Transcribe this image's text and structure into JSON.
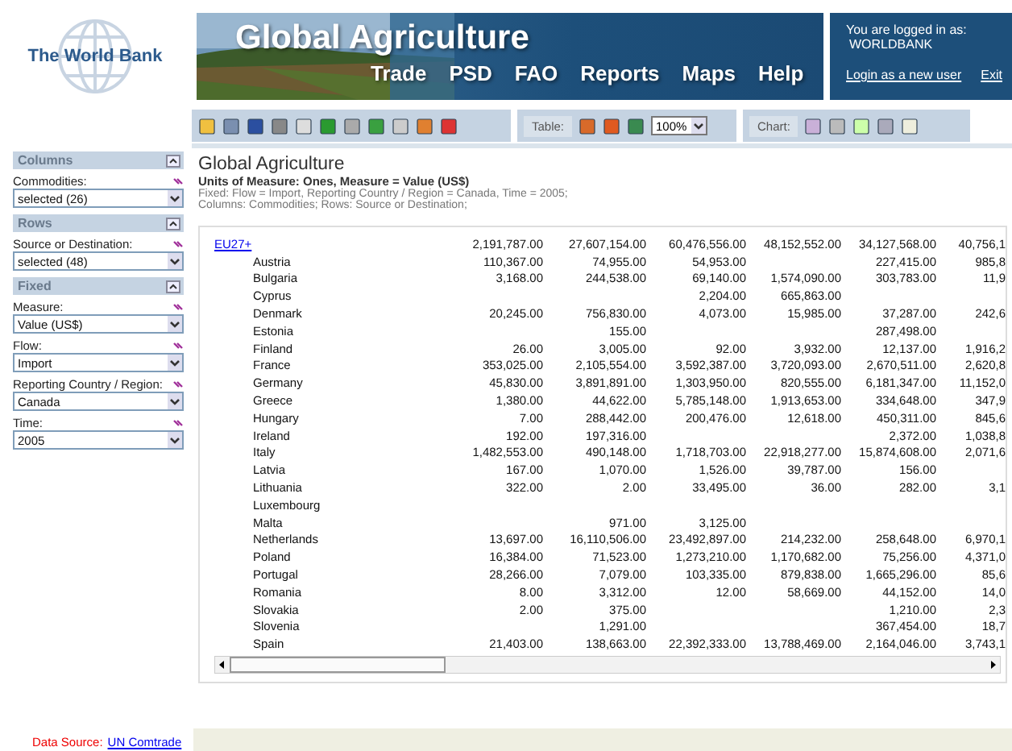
{
  "header": {
    "logo": "The World Bank",
    "title": "Global Agriculture",
    "nav": [
      "Trade",
      "PSD",
      "FAO",
      "Reports",
      "Maps",
      "Help"
    ],
    "login": {
      "label": "You are logged in as:",
      "user": "WORLDBANK",
      "link": "Login as a new user",
      "exit": "Exit"
    }
  },
  "toolbar": {
    "table_label": "Table:",
    "zoom": "100%",
    "chart_label": "Chart:"
  },
  "sidebar": [
    {
      "title": "Columns",
      "fields": [
        {
          "label": "Commodities:",
          "value": "selected (26)"
        }
      ]
    },
    {
      "title": "Rows",
      "fields": [
        {
          "label": "Source or Destination:",
          "value": "selected (48)"
        }
      ]
    },
    {
      "title": "Fixed",
      "fields": [
        {
          "label": "Measure:",
          "value": "Value (US$)"
        },
        {
          "label": "Flow:",
          "value": "Import"
        },
        {
          "label": "Reporting Country / Region:",
          "value": "Canada"
        },
        {
          "label": "Time:",
          "value": "2005"
        }
      ]
    }
  ],
  "report": {
    "title": "Global Agriculture",
    "units": "Units of Measure: Ones, Measure = Value (US$)",
    "fixed": "Fixed: Flow = Import, Reporting Country / Region = Canada, Time = 2005;",
    "layout": "Columns: Commodities; Rows: Source or Destination;"
  },
  "table": {
    "rows": [
      {
        "name": "EU27+",
        "column_1": "2,191,787.00",
        "column_2": "27,607,154.00",
        "column_3": "60,476,556.00",
        "column_4": "48,152,552.00",
        "column_5": "34,127,568.00",
        "column_6": "40,756,1",
        "children": [
          {
            "name": "Austria",
            "column_1": "110,367.00",
            "column_2": "74,955.00",
            "column_3": "54,953.00",
            "column_5": "227,415.00",
            "column_6": "985,8"
          },
          {
            "name": "Bulgaria",
            "column_1": "3,168.00",
            "column_2": "244,538.00",
            "column_3": "69,140.00",
            "column_4": "1,574,090.00",
            "column_5": "303,783.00",
            "column_6": "11,9"
          },
          {
            "name": "Cyprus",
            "column_3": "2,204.00",
            "column_4": "665,863.00"
          },
          {
            "name": "Denmark",
            "column_1": "20,245.00",
            "column_2": "756,830.00",
            "column_3": "4,073.00",
            "column_4": "15,985.00",
            "column_5": "37,287.00",
            "column_6": "242,6"
          },
          {
            "name": "Estonia",
            "column_2": "155.00",
            "column_5": "287,498.00"
          },
          {
            "name": "Finland",
            "column_1": "26.00",
            "column_2": "3,005.00",
            "column_3": "92.00",
            "column_4": "3,932.00",
            "column_5": "12,137.00",
            "column_6": "1,916,2"
          },
          {
            "name": "France",
            "column_1": "353,025.00",
            "column_2": "2,105,554.00",
            "column_3": "3,592,387.00",
            "column_4": "3,720,093.00",
            "column_5": "2,670,511.00",
            "column_6": "2,620,8"
          },
          {
            "name": "Germany",
            "column_1": "45,830.00",
            "column_2": "3,891,891.00",
            "column_3": "1,303,950.00",
            "column_4": "820,555.00",
            "column_5": "6,181,347.00",
            "column_6": "11,152,0"
          },
          {
            "name": "Greece",
            "column_1": "1,380.00",
            "column_2": "44,622.00",
            "column_3": "5,785,148.00",
            "column_4": "1,913,653.00",
            "column_5": "334,648.00",
            "column_6": "347,9"
          },
          {
            "name": "Hungary",
            "column_1": "7.00",
            "column_2": "288,442.00",
            "column_3": "200,476.00",
            "column_4": "12,618.00",
            "column_5": "450,311.00",
            "column_6": "845,6"
          },
          {
            "name": "Ireland",
            "column_1": "192.00",
            "column_2": "197,316.00",
            "column_5": "2,372.00",
            "column_6": "1,038,8"
          },
          {
            "name": "Italy",
            "column_1": "1,482,553.00",
            "column_2": "490,148.00",
            "column_3": "1,718,703.00",
            "column_4": "22,918,277.00",
            "column_5": "15,874,608.00",
            "column_6": "2,071,6"
          },
          {
            "name": "Latvia",
            "column_1": "167.00",
            "column_2": "1,070.00",
            "column_3": "1,526.00",
            "column_4": "39,787.00",
            "column_5": "156.00"
          },
          {
            "name": "Lithuania",
            "column_1": "322.00",
            "column_2": "2.00",
            "column_3": "33,495.00",
            "column_4": "36.00",
            "column_5": "282.00",
            "column_6": "3,1"
          },
          {
            "name": "Luxembourg"
          },
          {
            "name": "Malta",
            "column_2": "971.00",
            "column_3": "3,125.00"
          },
          {
            "name": "Netherlands",
            "column_1": "13,697.00",
            "column_2": "16,110,506.00",
            "column_3": "23,492,897.00",
            "column_4": "214,232.00",
            "column_5": "258,648.00",
            "column_6": "6,970,1"
          },
          {
            "name": "Poland",
            "column_1": "16,384.00",
            "column_2": "71,523.00",
            "column_3": "1,273,210.00",
            "column_4": "1,170,682.00",
            "column_5": "75,256.00",
            "column_6": "4,371,0"
          },
          {
            "name": "Portugal",
            "column_1": "28,266.00",
            "column_2": "7,079.00",
            "column_3": "103,335.00",
            "column_4": "879,838.00",
            "column_5": "1,665,296.00",
            "column_6": "85,6"
          },
          {
            "name": "Romania",
            "column_1": "8.00",
            "column_2": "3,312.00",
            "column_3": "12.00",
            "column_4": "58,669.00",
            "column_5": "44,152.00",
            "column_6": "14,0"
          },
          {
            "name": "Slovakia",
            "column_1": "2.00",
            "column_2": "375.00",
            "column_5": "1,210.00",
            "column_6": "2,3"
          },
          {
            "name": "Slovenia",
            "column_2": "1,291.00",
            "column_5": "367,454.00",
            "column_6": "18,7"
          },
          {
            "name": "Spain",
            "column_1": "21,403.00",
            "column_2": "138,663.00",
            "column_3": "22,392,333.00",
            "column_4": "13,788,469.00",
            "column_5": "2,164,046.00",
            "column_6": "3,743,1"
          }
        ]
      }
    ]
  },
  "footer": {
    "label": "Data Source:",
    "link": "UN Comtrade"
  }
}
